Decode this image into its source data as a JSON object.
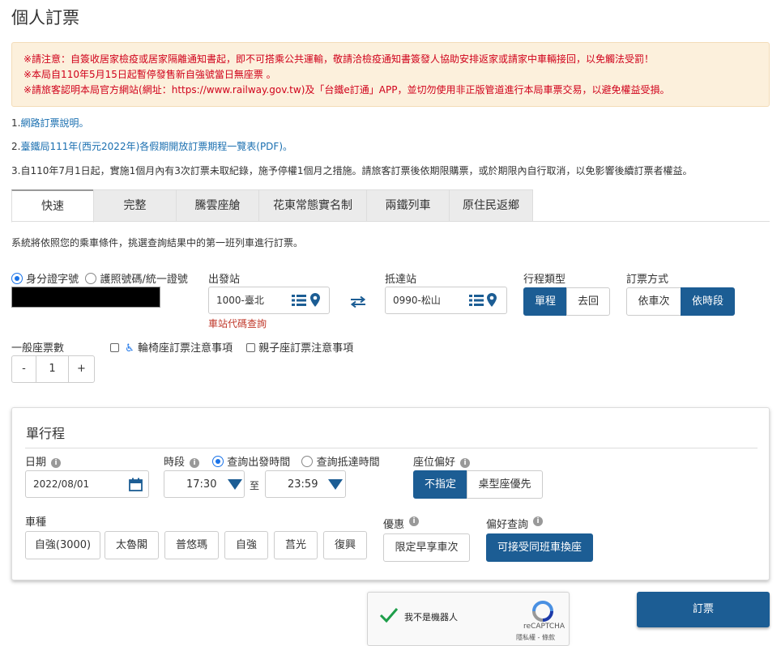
{
  "page": {
    "title": "個人訂票"
  },
  "notice": {
    "lines": [
      "※請注意：自簽收居家檢疫或居家隔離通知書起，即不可搭乘公共運輸，敬請洽檢疫通知書簽發人協助安排返家或請家中車輛接回，以免觸法受罰！",
      "※本局自110年5月15日起暫停發售新自強號當日無座票 。",
      "※請旅客認明本局官方網站(網址：https://www.railway.gov.tw)及「台鐵e訂通」APP，並切勿使用非正版管道進行本局車票交易，以避免權益受損。"
    ]
  },
  "info": {
    "item1_prefix": "1.",
    "item1_link": "網路訂票說明。",
    "item2_prefix": "2.",
    "item2_link": "臺鐵局111年(西元2022年)各假期開放訂票期程一覽表(PDF)。",
    "item3": "3.自110年7月1日起，實施1個月內有3次訂票未取紀錄，施予停權1個月之措施。請旅客訂票後依期限購票，或於期限內自行取消，以免影響後續訂票者權益。"
  },
  "tabs": [
    "快速",
    "完整",
    "騰雲座艙",
    "花東常態實名制",
    "兩鐵列車",
    "原住民返鄉"
  ],
  "description": "系統將依照您的乘車條件，挑選查詢結果中的第一班列車進行訂票。",
  "id_type": {
    "option1": "身分證字號",
    "option2": "護照號碼/統一證號"
  },
  "departure": {
    "label": "出發站",
    "value": "1000-臺北",
    "lookup_link": "車站代碼查詢"
  },
  "arrival": {
    "label": "抵達站",
    "value": "0990-松山"
  },
  "trip_type": {
    "label": "行程類型",
    "one_way": "單程",
    "round_trip": "去回"
  },
  "order_method": {
    "label": "訂票方式",
    "by_train": "依車次",
    "by_time": "依時段"
  },
  "tickets": {
    "label": "一般座票數",
    "minus": "-",
    "count": "1",
    "plus": "+"
  },
  "options": {
    "wheelchair": "輪椅座訂票注意事項",
    "family": "親子座訂票注意事項"
  },
  "oneway_panel": {
    "title": "單行程",
    "date_label": "日期",
    "date_value": "2022/08/01",
    "time_label": "時段",
    "time_depart": "查詢出發時間",
    "time_arrive": "查詢抵達時間",
    "time_from": "17:30",
    "time_to_word": "至",
    "time_to": "23:59",
    "seat_label": "座位偏好",
    "seat_none": "不指定",
    "seat_table": "桌型座優先",
    "train_type_label": "車種",
    "train_types": [
      "自強(3000)",
      "太魯閣",
      "普悠瑪",
      "自強",
      "莒光",
      "復興"
    ],
    "discount_label": "優惠",
    "discount_value": "限定早享車次",
    "pref_label": "偏好查詢",
    "pref_value": "可接受同班車換座"
  },
  "captcha": {
    "label": "我不是機器人",
    "brand": "reCAPTCHA",
    "links": "隱私權 - 條款"
  },
  "submit": "訂票",
  "colors": {
    "primary": "#1c5d94",
    "notice_bg": "#fcf0dc",
    "notice_text": "#d0021b",
    "link": "#1a6fb0"
  }
}
